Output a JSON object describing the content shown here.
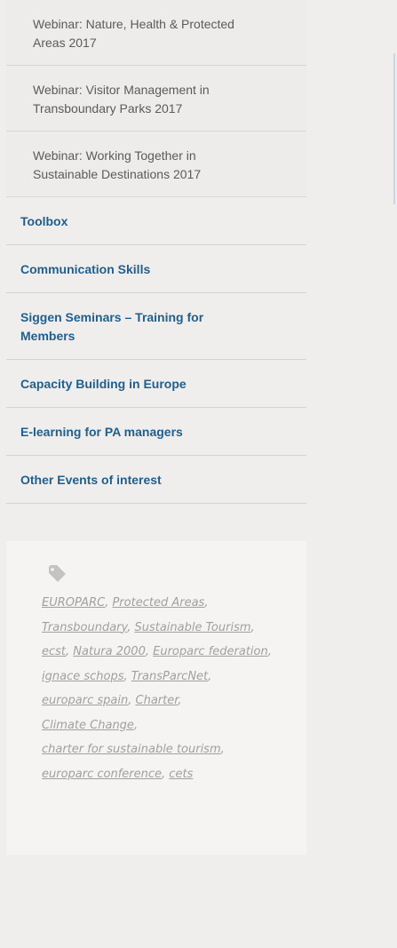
{
  "sub_items": [
    {
      "line1": "Webinar: Nature, Health & Protected",
      "line2": "Areas 2017"
    },
    {
      "line1": "Webinar: Visitor Management in",
      "line2": "Transboundary Parks 2017"
    },
    {
      "line1": "Webinar: Working Together in",
      "line2": "Sustainable Destinations 2017"
    }
  ],
  "main_items": [
    {
      "line1": "Toolbox",
      "line2": ""
    },
    {
      "line1": "Communication Skills",
      "line2": ""
    },
    {
      "line1": "Siggen Seminars – Training for",
      "line2": "Members"
    },
    {
      "line1": "Capacity Building in Europe",
      "line2": ""
    },
    {
      "line1": "E-learning for PA managers",
      "line2": ""
    },
    {
      "line1": "Other Events of interest",
      "line2": ""
    }
  ],
  "tags": {
    "icon": "tag-icon",
    "items": [
      "EUROPARC",
      "Protected Areas",
      "Transboundary",
      "Sustainable Tourism",
      "ecst",
      "Natura 2000",
      "Europarc federation",
      "ignace schops",
      "TransParcNet",
      "europarc spain",
      "Charter",
      "Climate Change",
      "charter for sustainable tourism",
      "europarc conference",
      "cets"
    ]
  },
  "colors": {
    "link_blue": "#1f5f8e",
    "tag_gray": "#a0a09e"
  }
}
